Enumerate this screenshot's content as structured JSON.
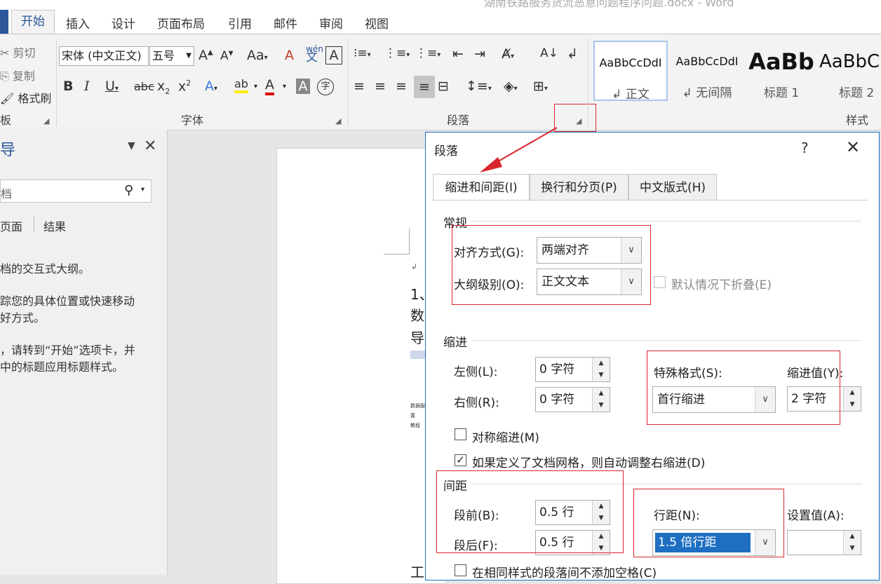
{
  "window": {
    "title": "湖南铁路服务货流恶意问题程序问题.docx - Word"
  },
  "ribbon_tabs": [
    "开始",
    "插入",
    "设计",
    "页面布局",
    "引用",
    "邮件",
    "审阅",
    "视图"
  ],
  "clipboard": {
    "cut": "剪切",
    "copy": "复制",
    "format_painter": "格式刷",
    "group": "板"
  },
  "font": {
    "name": "宋体 (中文正文)",
    "size": "五号",
    "group": "字体"
  },
  "paragraph_group": "段落",
  "styles": {
    "group": "样式",
    "items": [
      {
        "preview": "AaBbCcDdI",
        "name": "↲ 正文"
      },
      {
        "preview": "AaBbCcDdI",
        "name": "↲ 无间隔"
      },
      {
        "preview": "AaBb",
        "name": "标题 1"
      },
      {
        "preview": "AaBbC",
        "name": "标题 2"
      }
    ]
  },
  "nav": {
    "title": "导",
    "search_placeholder": "档",
    "tabs": [
      "页面",
      "结果"
    ],
    "lines": [
      "档的交互式大纲。",
      "踪您的具体位置或快速移动",
      "好方式。",
      "，请转到“开始”选项卡，并",
      "中的标题应用标题样式。"
    ]
  },
  "document": {
    "lines": [
      "1、",
      "数",
      "导",
      "工"
    ],
    "mini_lines": [
      "数据服务",
      "置",
      "教程"
    ]
  },
  "dialog": {
    "title": "段落",
    "help": "?",
    "tabs": [
      "缩进和间距(I)",
      "换行和分页(P)",
      "中文版式(H)"
    ],
    "general": {
      "heading": "常规",
      "alignment_label": "对齐方式(G):",
      "alignment_value": "两端对齐",
      "outline_label": "大纲级别(O):",
      "outline_value": "正文文本",
      "collapse_label": "默认情况下折叠(E)"
    },
    "indent": {
      "heading": "缩进",
      "left_label": "左侧(L):",
      "left_value": "0 字符",
      "right_label": "右侧(R):",
      "right_value": "0 字符",
      "special_label": "特殊格式(S):",
      "special_value": "首行缩进",
      "by_label": "缩进值(Y):",
      "by_value": "2 字符",
      "mirror_label": "对称缩进(M)",
      "auto_right_label": "如果定义了文档网格，则自动调整右缩进(D)"
    },
    "spacing": {
      "heading": "间距",
      "before_label": "段前(B):",
      "before_value": "0.5 行",
      "after_label": "段后(F):",
      "after_value": "0.5 行",
      "line_label": "行距(N):",
      "line_value": "1.5 倍行距",
      "at_label": "设置值(A):",
      "at_value": "",
      "no_space_label": "在相同样式的段落间不添加空格(C)"
    }
  },
  "colors": {
    "accent": "#2b579a",
    "annotation": "#d9262c",
    "selection": "#1e6fc2"
  }
}
